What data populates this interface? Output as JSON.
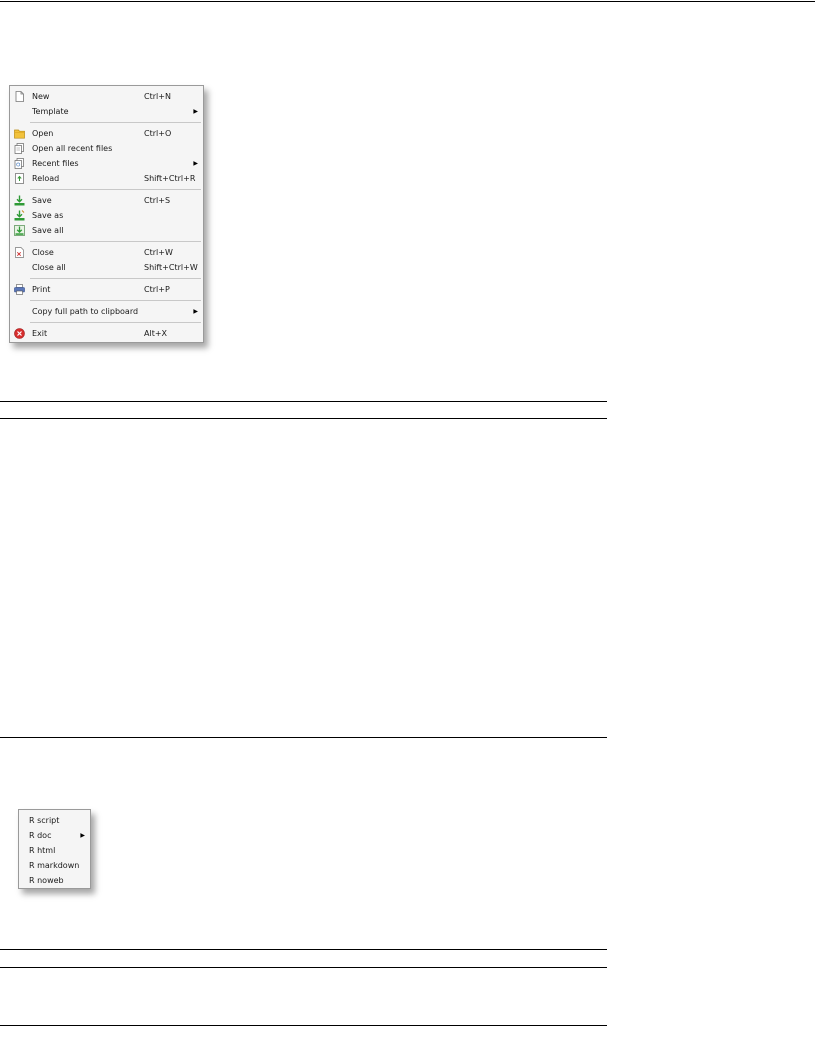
{
  "file_menu": {
    "items": [
      {
        "label": "New",
        "shortcut": "Ctrl+N",
        "icon": "new-file-icon"
      },
      {
        "label": "Template",
        "shortcut": "",
        "submenu": true
      },
      {
        "separator": true
      },
      {
        "label": "Open",
        "shortcut": "Ctrl+O",
        "icon": "open-folder-icon"
      },
      {
        "label": "Open all recent files",
        "shortcut": "",
        "icon": "open-all-icon"
      },
      {
        "label": "Recent files",
        "shortcut": "",
        "icon": "recent-files-icon",
        "submenu": true
      },
      {
        "label": "Reload",
        "shortcut": "Shift+Ctrl+R",
        "icon": "reload-icon"
      },
      {
        "separator": true
      },
      {
        "label": "Save",
        "shortcut": "Ctrl+S",
        "icon": "save-icon"
      },
      {
        "label": "Save as",
        "shortcut": "",
        "icon": "save-as-icon"
      },
      {
        "label": "Save all",
        "shortcut": "",
        "icon": "save-all-icon"
      },
      {
        "separator": true
      },
      {
        "label": "Close",
        "shortcut": "Ctrl+W",
        "icon": "close-file-icon"
      },
      {
        "label": "Close all",
        "shortcut": "Shift+Ctrl+W"
      },
      {
        "separator": true
      },
      {
        "label": "Print",
        "shortcut": "Ctrl+P",
        "icon": "print-icon"
      },
      {
        "separator": true
      },
      {
        "label": "Copy full path to clipboard",
        "shortcut": "",
        "submenu": true
      },
      {
        "separator": true
      },
      {
        "label": "Exit",
        "shortcut": "Alt+X",
        "icon": "exit-icon"
      }
    ]
  },
  "template_menu": {
    "items": [
      {
        "label": "R script"
      },
      {
        "label": "R doc",
        "submenu": true
      },
      {
        "label": "R html"
      },
      {
        "label": "R markdown"
      },
      {
        "label": "R noweb"
      }
    ]
  },
  "colors": {
    "menu_bg": "#f5f5f5",
    "menu_border": "#9a9a9a",
    "separator": "#c8c8c8"
  }
}
